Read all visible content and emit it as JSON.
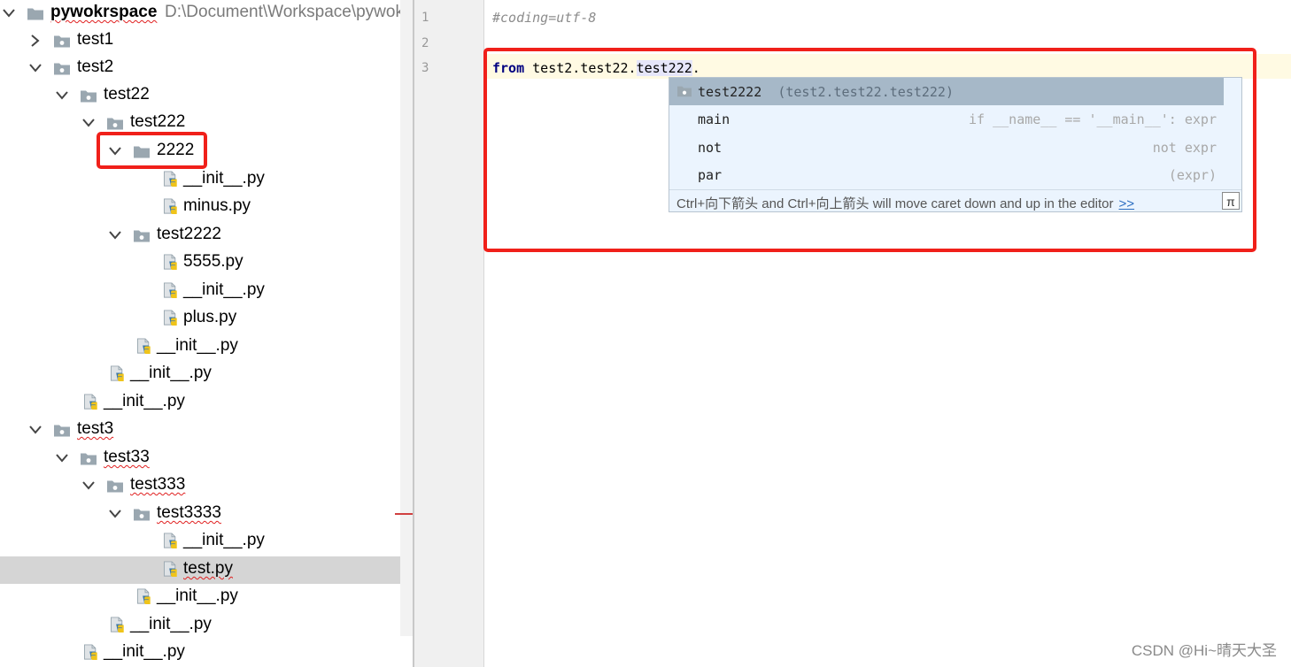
{
  "project_tree": {
    "root": {
      "label": "pywokrspace",
      "path": "D:\\Document\\Workspace\\pywokrspace"
    },
    "items": [
      {
        "label": "test1"
      },
      {
        "label": "test2"
      },
      {
        "label": "test22"
      },
      {
        "label": "test222"
      },
      {
        "label": "2222"
      },
      {
        "label": "__init__.py"
      },
      {
        "label": "minus.py"
      },
      {
        "label": "test2222"
      },
      {
        "label": "5555.py"
      },
      {
        "label": "__init__.py"
      },
      {
        "label": "plus.py"
      },
      {
        "label": "__init__.py"
      },
      {
        "label": "__init__.py"
      },
      {
        "label": "__init__.py"
      },
      {
        "label": "test3"
      },
      {
        "label": "test33"
      },
      {
        "label": "test333"
      },
      {
        "label": "test3333"
      },
      {
        "label": "__init__.py"
      },
      {
        "label": "test.py"
      },
      {
        "label": "__init__.py"
      },
      {
        "label": "__init__.py"
      },
      {
        "label": "__init__.py"
      }
    ],
    "selected_label": "test.py"
  },
  "editor": {
    "line_numbers": [
      "1",
      "2",
      "3"
    ],
    "line1_comment": "#coding=utf-8",
    "line3": {
      "keyword": "from",
      "module": " test2.test22.",
      "highlight": "test222",
      "dot": "."
    }
  },
  "completion_popup": {
    "items": [
      {
        "name": "test2222",
        "hint": "(test2.test22.test222)"
      },
      {
        "name": "main",
        "hint": "if __name__ == '__main__': expr"
      },
      {
        "name": "not",
        "hint": "not expr"
      },
      {
        "name": "par",
        "hint": "(expr)"
      }
    ],
    "footer_text": "Ctrl+向下箭头 and Ctrl+向上箭头 will move caret down and up in the editor",
    "footer_link": ">>",
    "pin_glyph": "π"
  },
  "watermark": "CSDN @Hi~晴天大圣",
  "colors": {
    "annotation_red": "#f0201a",
    "caret_line": "#fffae3",
    "popup_bg": "#ebf4fe",
    "popup_selected": "#a6b8c8",
    "keyword": "#000080"
  }
}
